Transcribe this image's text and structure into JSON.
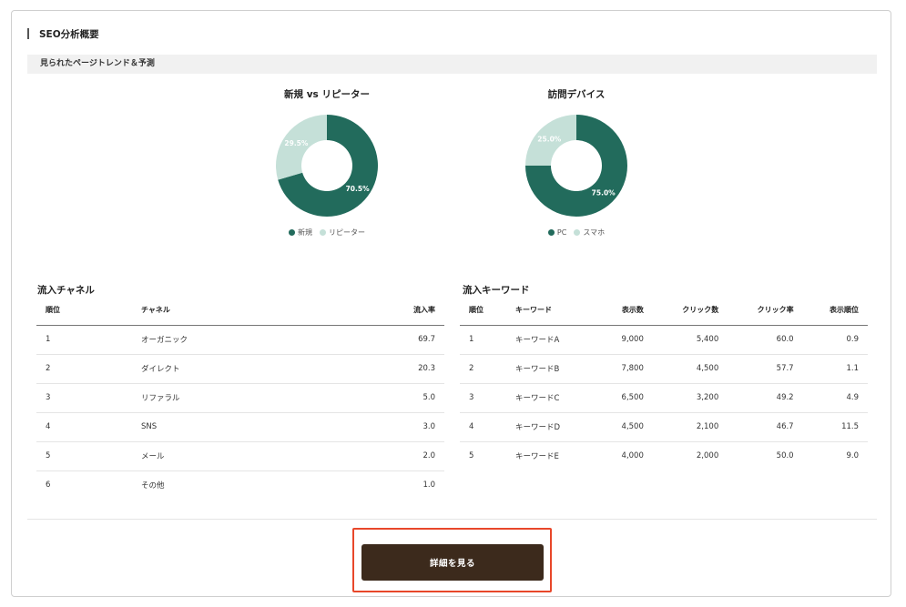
{
  "card": {
    "title": "SEO分析概要"
  },
  "subhead": "見られたページトレンド＆予測",
  "colors": {
    "primary": "#226b5c",
    "secondary": "#c5e0d8",
    "button": "#3c2a1c",
    "highlight": "#e8472a"
  },
  "charts": [
    {
      "title": "新規 vs リピーター",
      "type": "pie",
      "slices": [
        {
          "label": "新規",
          "value": 70.5,
          "text": "70.5%"
        },
        {
          "label": "リピーター",
          "value": 29.5,
          "text": "29.5%"
        }
      ]
    },
    {
      "title": "訪問デバイス",
      "type": "pie",
      "slices": [
        {
          "label": "PC",
          "value": 75.0,
          "text": "75.0%"
        },
        {
          "label": "スマホ",
          "value": 25.0,
          "text": "25.0%"
        }
      ]
    }
  ],
  "channels": {
    "title": "流入チャネル",
    "headers": [
      "順位",
      "チャネル",
      "流入率"
    ],
    "rows": [
      [
        "1",
        "オーガニック",
        "69.7"
      ],
      [
        "2",
        "ダイレクト",
        "20.3"
      ],
      [
        "3",
        "リファラル",
        "5.0"
      ],
      [
        "4",
        "SNS",
        "3.0"
      ],
      [
        "5",
        "メール",
        "2.0"
      ],
      [
        "6",
        "その他",
        "1.0"
      ]
    ]
  },
  "keywords": {
    "title": "流入キーワード",
    "headers": [
      "順位",
      "キーワード",
      "表示数",
      "クリック数",
      "クリック率",
      "表示順位"
    ],
    "rows": [
      [
        "1",
        "キーワードA",
        "9,000",
        "5,400",
        "60.0",
        "0.9"
      ],
      [
        "2",
        "キーワードB",
        "7,800",
        "4,500",
        "57.7",
        "1.1"
      ],
      [
        "3",
        "キーワードC",
        "6,500",
        "3,200",
        "49.2",
        "4.9"
      ],
      [
        "4",
        "キーワードD",
        "4,500",
        "2,100",
        "46.7",
        "11.5"
      ],
      [
        "5",
        "キーワードE",
        "4,000",
        "2,000",
        "50.0",
        "9.0"
      ]
    ]
  },
  "button": {
    "label": "詳細を見る"
  }
}
